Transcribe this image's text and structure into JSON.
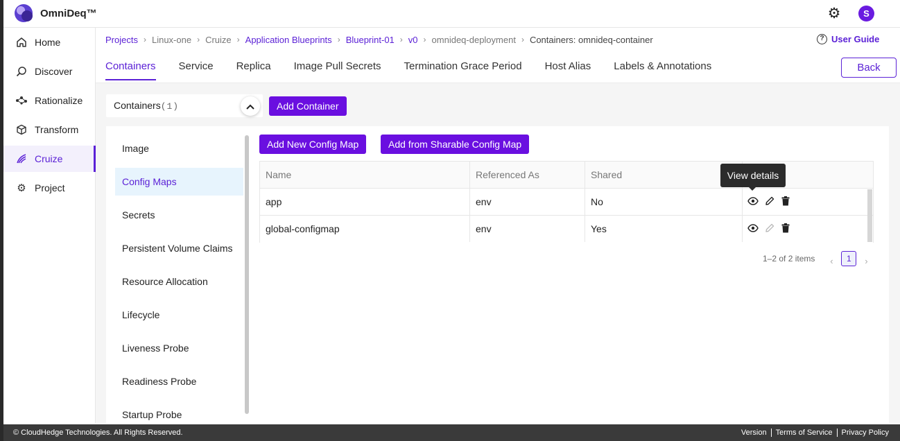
{
  "header": {
    "brand": "OmniDeq™",
    "avatar_initial": "S"
  },
  "sidebar": {
    "items": [
      {
        "label": "Home",
        "icon": "home-icon"
      },
      {
        "label": "Discover",
        "icon": "search-icon"
      },
      {
        "label": "Rationalize",
        "icon": "nodes-icon"
      },
      {
        "label": "Transform",
        "icon": "cube-icon"
      },
      {
        "label": "Cruize",
        "icon": "cruize-icon",
        "active": true
      },
      {
        "label": "Project",
        "icon": "gear-icon"
      }
    ]
  },
  "breadcrumb": {
    "items": [
      "Projects",
      "Linux-one",
      "Cruize",
      "Application Blueprints",
      "Blueprint-01",
      "v0",
      "omnideq-deployment",
      "Containers: omnideq-container"
    ]
  },
  "user_guide": "User Guide",
  "tabs": [
    "Containers",
    "Service",
    "Replica",
    "Image Pull Secrets",
    "Termination Grace Period",
    "Host Alias",
    "Labels & Annotations"
  ],
  "back_label": "Back",
  "containers": {
    "label": "Containers",
    "count": "(1)",
    "add_label": "Add Container"
  },
  "subnav": [
    "Image",
    "Config Maps",
    "Secrets",
    "Persistent Volume Claims",
    "Resource Allocation",
    "Lifecycle",
    "Liveness Probe",
    "Readiness Probe",
    "Startup Probe"
  ],
  "config_buttons": {
    "add_new": "Add New Config Map",
    "add_sharable": "Add from Sharable Config Map"
  },
  "table": {
    "headers": [
      "Name",
      "Referenced As",
      "Shared",
      ""
    ],
    "rows": [
      {
        "name": "app",
        "ref": "env",
        "shared": "No",
        "edit_enabled": true
      },
      {
        "name": "global-configmap",
        "ref": "env",
        "shared": "Yes",
        "edit_enabled": false
      }
    ]
  },
  "tooltip": "View details",
  "pagination": {
    "summary": "1–2 of 2 items",
    "page": "1"
  },
  "footer": {
    "copyright": "© CloudHedge Technologies. All Rights Reserved.",
    "links": [
      "Version",
      "Terms of Service",
      "Privacy Policy"
    ]
  },
  "colors": {
    "accent": "#5b21d6",
    "button": "#6a0fe0"
  }
}
